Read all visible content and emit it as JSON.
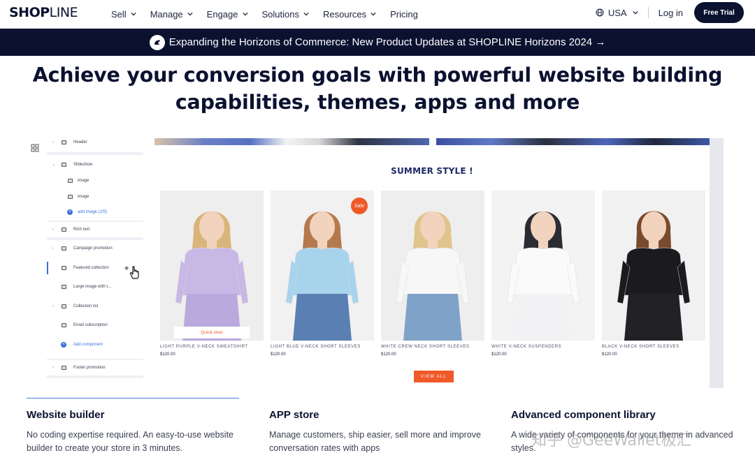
{
  "nav": {
    "logo_bold": "SHOP",
    "logo_light": "LINE",
    "menu": [
      {
        "label": "Sell",
        "has_dropdown": true
      },
      {
        "label": "Manage",
        "has_dropdown": true
      },
      {
        "label": "Engage",
        "has_dropdown": true
      },
      {
        "label": "Solutions",
        "has_dropdown": true
      },
      {
        "label": "Resources",
        "has_dropdown": true
      },
      {
        "label": "Pricing",
        "has_dropdown": false
      }
    ],
    "region": "USA",
    "login": "Log in",
    "cta": "Free Trial"
  },
  "banner": {
    "text": "Expanding the Horizons of Commerce: New Product Updates at SHOPLINE Horizons 2024 →"
  },
  "headline": {
    "line1": "Achieve your conversion goals with powerful website building",
    "line2": "capabilities, themes, apps and more"
  },
  "editor": {
    "items": [
      {
        "label": "Header",
        "arrow": "›"
      },
      {
        "label": "Slideshow",
        "arrow": "⌄"
      },
      {
        "label": "image"
      },
      {
        "label": "image"
      },
      {
        "label": "add image (2/5)"
      },
      {
        "label": "Rich text",
        "arrow": "›"
      },
      {
        "label": "Campaign promotion",
        "arrow": "›"
      },
      {
        "label": "Featured collection"
      },
      {
        "label": "Large image with t..."
      },
      {
        "label": "Collection list",
        "arrow": "›"
      },
      {
        "label": "Email subscription"
      },
      {
        "label": "Add component"
      },
      {
        "label": "Footer promotion",
        "arrow": "›"
      }
    ]
  },
  "preview": {
    "section_title": "SUMMER STYLE !",
    "products": [
      {
        "name": "LIGHT PURPLE V-NECK SWEATSHIRT",
        "price": "$120.00",
        "quick_view": "Quick view",
        "top": "#c7b8e6",
        "bottom": "#b9a9dc",
        "hair": "#d9b57a",
        "bg": "#eeeeee"
      },
      {
        "name": "LIGHT BLUE V-NECK SHORT SLEEVES",
        "price": "$120.00",
        "badge": "Sale",
        "top": "#a8d3ec",
        "bottom": "#5a7fb2",
        "hair": "#b47a4d",
        "bg": "#f1f1f1"
      },
      {
        "name": "WHITE CREW NECK SHORT SLEEVES",
        "price": "$120.00",
        "top": "#f7f7f7",
        "bottom": "#7fa3c8",
        "hair": "#e0c48c",
        "bg": "#eeeeee"
      },
      {
        "name": "WHITE V-NECK SUSPENDERS",
        "price": "$120.00",
        "top": "#fafafa",
        "bottom": "#f2f2f5",
        "hair": "#2b2b33",
        "bg": "#f3f3f3"
      },
      {
        "name": "BLACK V-NECK SHORT SLEEVES",
        "price": "$120.00",
        "top": "#1b1b1f",
        "bottom": "#222226",
        "hair": "#7a4a2c",
        "bg": "#f1f1f1"
      }
    ],
    "view_all": "VIEW ALL"
  },
  "features": [
    {
      "title": "Website builder",
      "desc": "No coding expertise required. An easy-to-use website builder to create your store in 3 minutes."
    },
    {
      "title": "APP store",
      "desc": "Manage customers, ship easier, sell more and improve conversation rates with apps"
    },
    {
      "title": "Advanced component library",
      "desc": "A wide variety of components for your theme in advanced styles."
    }
  ],
  "watermark": "知乎 @GeeWallet极汇",
  "colors": {
    "navy": "#0b1230",
    "accent_orange": "#f05a28",
    "editor_blue": "#3b6fe0"
  }
}
